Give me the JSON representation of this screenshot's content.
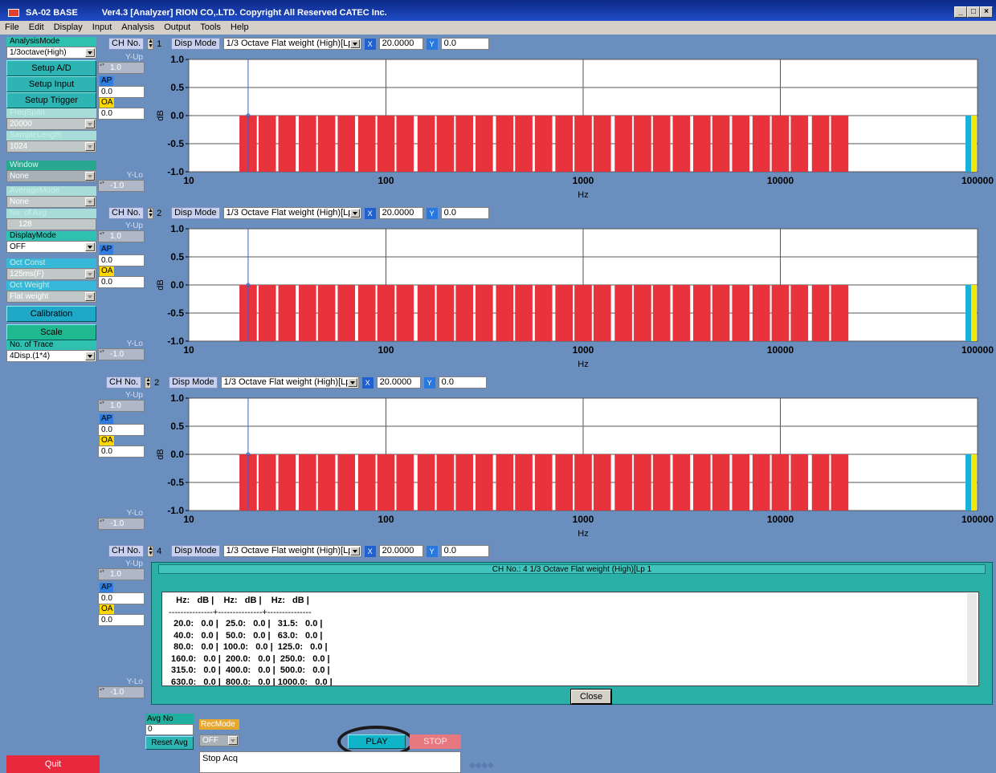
{
  "window": {
    "title": "SA-02 BASE",
    "version": "Ver4.3 [Analyzer] RION CO,.LTD.  Copyright All Reserved CATEC Inc."
  },
  "menu": [
    "File",
    "Edit",
    "Display",
    "Input",
    "Analysis",
    "Output",
    "Tools",
    "Help"
  ],
  "left": {
    "analysis_mode_label": "AnalysisMode",
    "analysis_mode_value": "1/3octave(High)",
    "setup_ad": "Setup A/D",
    "setup_input": "Setup Input",
    "setup_trigger": "Setup Trigger",
    "freqspan_label": "FreqSpan",
    "freqspan_value": "20000",
    "samplelength_label": "SampleLength",
    "samplelength_value": "1024",
    "window_label": "Window",
    "window_value": "None",
    "averagemode_label": "AverageMode",
    "averagemode_value": "None",
    "noofavg_label": "No. of Avg",
    "noofavg_value": "128",
    "displaymode_label": "DisplayMode",
    "displaymode_value": "OFF",
    "octconst_label": "Oct Const",
    "octconst_value": "125ms(F)",
    "octweight_label": "Oct  Weight",
    "octweight_value": "Flat weight",
    "calibration": "Calibration",
    "scale": "Scale",
    "nooftrace_label": "No. of Trace",
    "nooftrace_value": "4Disp.(1*4)",
    "quit": "Quit"
  },
  "side": {
    "yup": "Y-Up",
    "ylo": "Y-Lo",
    "yup_val": "1.0",
    "ylo_val": "-1.0",
    "ap": "AP",
    "oa": "OA",
    "ap_val": "0.0",
    "oa_val": "0.0"
  },
  "channels": [
    {
      "ch_label": "CH No.",
      "ch_no": "1",
      "disp_mode_label": "Disp Mode",
      "disp_mode": "1/3 Octave Flat weight (High)[Lp",
      "x_btn": "X",
      "x_val": "20.0000",
      "y_btn": "Y",
      "y_val": "0.0"
    },
    {
      "ch_label": "CH No.",
      "ch_no": "2",
      "disp_mode_label": "Disp Mode",
      "disp_mode": "1/3 Octave Flat weight (High)[Lp",
      "x_btn": "X",
      "x_val": "20.0000",
      "y_btn": "Y",
      "y_val": "0.0"
    },
    {
      "ch_label": "CH No.",
      "ch_no": "2",
      "disp_mode_label": "Disp Mode",
      "disp_mode": "1/3 Octave Flat weight (High)[Lp",
      "x_btn": "X",
      "x_val": "20.0000",
      "y_btn": "Y",
      "y_val": "0.0"
    },
    {
      "ch_label": "CH No.",
      "ch_no": "4",
      "disp_mode_label": "Disp Mode",
      "disp_mode": "1/3 Octave Flat weight (High)[Lp",
      "x_btn": "X",
      "x_val": "20.0000",
      "y_btn": "Y",
      "y_val": "0.0"
    }
  ],
  "chart_data": {
    "type": "bar",
    "xlabel": "Hz",
    "ylabel": "dB",
    "xscale": "log",
    "xlim": [
      10,
      100000
    ],
    "ylim": [
      -1.0,
      1.0
    ],
    "xticks": [
      "10",
      "100",
      "1000",
      "10000",
      "100000"
    ],
    "yticks": [
      "1.0",
      "0.5",
      "0.0",
      "-0.5",
      "-1.0"
    ],
    "bar_range_db": [
      -1.0,
      0.0
    ],
    "categories": [
      20,
      25,
      31.5,
      40,
      50,
      63,
      80,
      100,
      125,
      160,
      200,
      250,
      315,
      400,
      500,
      630,
      800,
      1000,
      1250,
      1600,
      2000,
      2500,
      3150,
      4000,
      5000,
      6300,
      8000,
      10000,
      12500,
      16000,
      20000
    ],
    "values": [
      0,
      0,
      0,
      0,
      0,
      0,
      0,
      0,
      0,
      0,
      0,
      0,
      0,
      0,
      0,
      0,
      0,
      0,
      0,
      0,
      0,
      0,
      0,
      0,
      0,
      0,
      0,
      0,
      0,
      0,
      0
    ],
    "bar_color": "#e8323c",
    "overall_bars": [
      {
        "name": "AP",
        "value": 0.0,
        "color": "#1ab0d8"
      },
      {
        "name": "OA",
        "value": 0.0,
        "color": "#f0e800"
      }
    ],
    "cursor_hz": 20.0,
    "grid": true
  },
  "popup": {
    "title": "CH No.: 4    1/3 Octave Flat weight (High)[Lp  1",
    "header": "   Hz:   dB |    Hz:   dB |    Hz:   dB |",
    "sep": "---------------+---------------+---------------",
    "rows": [
      "  20.0:   0.0 |   25.0:   0.0 |   31.5:   0.0 |",
      "  40.0:   0.0 |   50.0:   0.0 |   63.0:   0.0 |",
      "  80.0:   0.0 |  100.0:   0.0 |  125.0:   0.0 |",
      " 160.0:   0.0 |  200.0:   0.0 |  250.0:   0.0 |",
      " 315.0:   0.0 |  400.0:   0.0 |  500.0:   0.0 |",
      " 630.0:   0.0 |  800.0:   0.0 | 1000.0:   0.0 |"
    ],
    "close": "Close"
  },
  "bottom": {
    "avgno_label": "Avg No",
    "avgno_value": "0",
    "reset_avg": "Reset Avg",
    "recmode_label": "RecMode",
    "recmode_value": "OFF",
    "play": "PLAY",
    "stop": "STOP",
    "status": "Stop Acq"
  }
}
